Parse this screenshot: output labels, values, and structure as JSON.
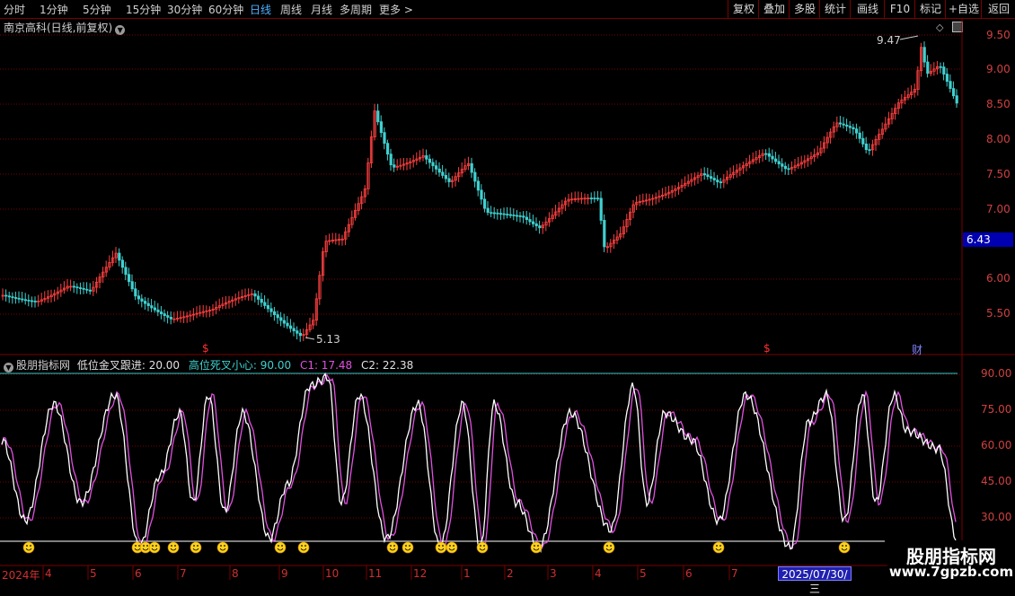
{
  "toolbar": {
    "periods": [
      "分时",
      "1分钟",
      "5分钟",
      "15分钟",
      "30分钟",
      "60分钟",
      "日线",
      "周线",
      "月线",
      "多周期",
      "更多 >"
    ],
    "active_period": "日线",
    "right_buttons": [
      "复权",
      "叠加",
      "多股",
      "统计",
      "画线",
      "F10",
      "标记",
      "+自选",
      "返回"
    ]
  },
  "main": {
    "title": "南京高科(日线,前复权)",
    "high_label": "9.47",
    "low_label": "5.13",
    "current_price": "6.43",
    "price_axis": [
      "9.50",
      "9.00",
      "8.50",
      "8.00",
      "7.50",
      "7.00",
      "6.00",
      "5.50"
    ],
    "markers": [
      {
        "text": "$",
        "color": "#ff3030"
      },
      {
        "text": "$",
        "color": "#ff3030"
      },
      {
        "text": "财",
        "color": "#8080ff"
      }
    ]
  },
  "indicator": {
    "name": "股朋指标网",
    "items": [
      {
        "label": "低位金叉跟进: 20.00",
        "color": "#e0e0e0"
      },
      {
        "label": "高位死叉小心: 90.00",
        "color": "#40d0d0"
      },
      {
        "label": "C1: 17.48",
        "color": "#e050e0"
      },
      {
        "label": "C2: 22.38",
        "color": "#e0e0e0"
      }
    ],
    "axis": [
      "90.00",
      "75.00",
      "60.00",
      "45.00",
      "30.00"
    ]
  },
  "date_axis": [
    "2024年",
    "4",
    "5",
    "6",
    "7",
    "8",
    "9",
    "10",
    "11",
    "12",
    "1",
    "2",
    "3",
    "4",
    "5",
    "6",
    "7"
  ],
  "cursor_date": "2025/07/30/三",
  "watermark": {
    "title": "股朋指标网",
    "url": "www.7gpzb.com"
  },
  "colors": {
    "up": "#ff4040",
    "down": "#40d0d0",
    "c1": "#e050e0",
    "c2": "#ffffff",
    "grid": "#7a0000"
  }
}
